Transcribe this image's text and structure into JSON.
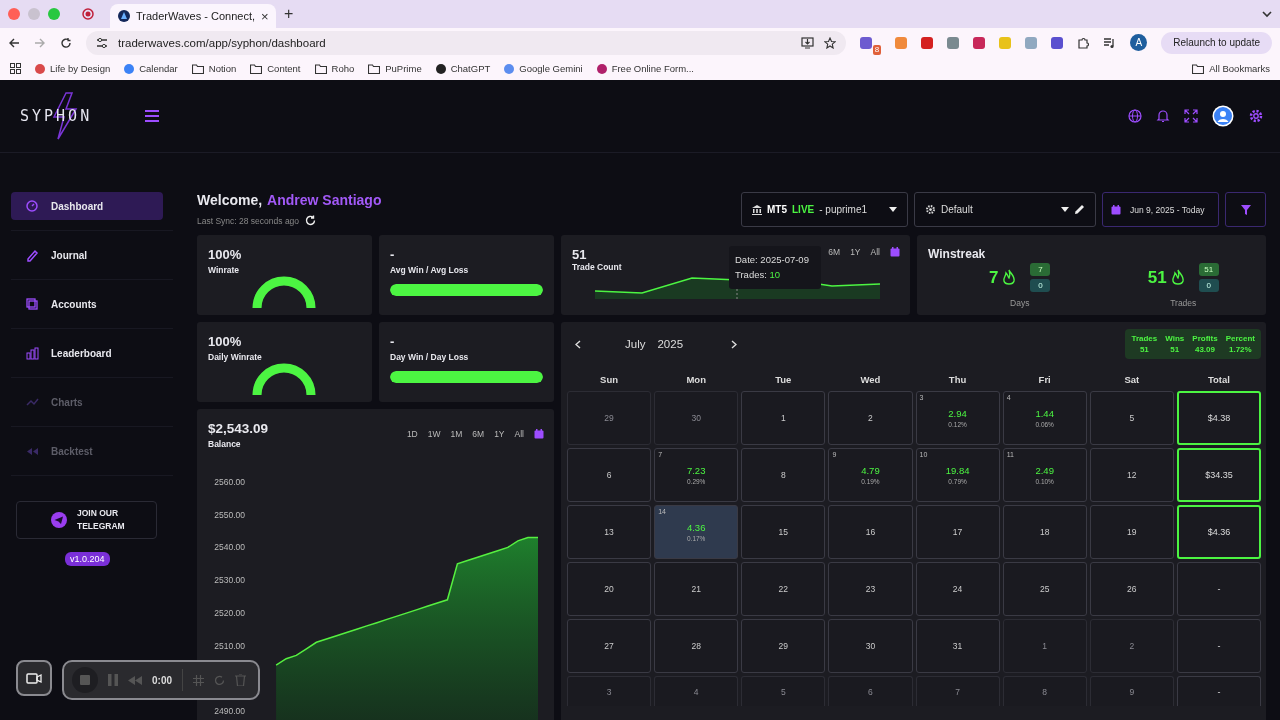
{
  "browser": {
    "tab": {
      "title": "TraderWaves - Connect,",
      "close": "×"
    },
    "new_tab": "+",
    "url": "traderwaves.com/app/syphon/dashboard",
    "extension_badge": "8",
    "profile_initial": "A",
    "relaunch": "Relaunch to update",
    "bookmarks": [
      {
        "label": "Life by Design",
        "kind": "site",
        "color": "#d94a4a"
      },
      {
        "label": "Calendar",
        "kind": "site",
        "color": "#3b82f6"
      },
      {
        "label": "Notion",
        "kind": "folder"
      },
      {
        "label": "Content",
        "kind": "folder"
      },
      {
        "label": "Roho",
        "kind": "folder"
      },
      {
        "label": "PuPrime",
        "kind": "folder"
      },
      {
        "label": "ChatGPT",
        "kind": "site",
        "color": "#222222"
      },
      {
        "label": "Google Gemini",
        "kind": "site",
        "color": "#5b8def"
      },
      {
        "label": "Free Online Form...",
        "kind": "site",
        "color": "#b0206a"
      }
    ],
    "all_bookmarks": "All Bookmarks"
  },
  "app": {
    "logo": "SYPHON",
    "sidebar": {
      "items": [
        {
          "label": "Dashboard",
          "selected": true,
          "disabled": false
        },
        {
          "label": "Journal",
          "selected": false,
          "disabled": false
        },
        {
          "label": "Accounts",
          "selected": false,
          "disabled": false
        },
        {
          "label": "Leaderboard",
          "selected": false,
          "disabled": false
        },
        {
          "label": "Charts",
          "selected": false,
          "disabled": true
        },
        {
          "label": "Backtest",
          "selected": false,
          "disabled": true
        }
      ],
      "telegram": "JOIN OUR TELEGRAM",
      "version": "v1.0.204"
    },
    "welcome": {
      "greeting": "Welcome,",
      "name": "Andrew Santiago",
      "last_sync": "Last Sync: 28 seconds ago"
    },
    "filters": {
      "account": {
        "platform": "MT5",
        "mode": "LIVE",
        "name": "- puprime1"
      },
      "layout": "Default",
      "date_range": "Jun 9, 2025 - Today"
    },
    "stats": [
      {
        "value": "100%",
        "label": "Winrate",
        "kind": "gauge",
        "level": 1
      },
      {
        "value": "-",
        "label": "Avg Win / Avg Loss",
        "kind": "bar",
        "level": 1
      },
      {
        "value": "100%",
        "label": "Daily Winrate",
        "kind": "gauge",
        "level": 1
      },
      {
        "value": "-",
        "label": "Day Win / Day Loss",
        "kind": "bar",
        "level": 1
      }
    ],
    "trade_count": {
      "value": "51",
      "label": "Trade Count",
      "ranges": [
        "6M",
        "1Y",
        "All"
      ],
      "tooltip": {
        "date": "Date: 2025-07-09",
        "label": "Trades:",
        "value": "10"
      }
    },
    "winstreak": {
      "title": "Winstreak",
      "groups": [
        {
          "value": "7",
          "wins": "7",
          "losses": "0",
          "label": "Days"
        },
        {
          "value": "51",
          "wins": "51",
          "losses": "0",
          "label": "Trades"
        }
      ]
    },
    "balance": {
      "value": "$2,543.09",
      "label": "Balance",
      "ranges": [
        "1D",
        "1W",
        "1M",
        "6M",
        "1Y",
        "All"
      ],
      "chart_data": {
        "type": "area",
        "ylim": [
          2490,
          2560
        ],
        "yticks": [
          {
            "value": 2490,
            "label": "2490.00"
          },
          {
            "value": 2510,
            "label": "2510.00"
          },
          {
            "value": 2520,
            "label": "2520.00"
          },
          {
            "value": 2530,
            "label": "2530.00"
          },
          {
            "value": 2540,
            "label": "2540.00"
          },
          {
            "value": 2550,
            "label": "2550.00"
          },
          {
            "value": 2560,
            "label": "2560.00"
          }
        ],
        "series": [
          {
            "color": "#56f040",
            "values": [
              null,
              null,
              2504,
              2506,
              2507,
              2509,
              2511,
              2512,
              2513,
              2514,
              2515,
              2516,
              2517,
              2518,
              2519,
              2520,
              2521,
              2522,
              2523,
              2524,
              2535,
              2536,
              2537,
              2538,
              2539,
              2540,
              2542,
              2543,
              2543
            ]
          }
        ]
      }
    },
    "calendar": {
      "month": "July",
      "year": "2025",
      "summary": [
        {
          "label": "Trades",
          "value": "51"
        },
        {
          "label": "Wins",
          "value": "51"
        },
        {
          "label": "Profits",
          "value": "43.09"
        },
        {
          "label": "Percent",
          "value": "1.72%"
        }
      ],
      "weekdays": [
        "Sun",
        "Mon",
        "Tue",
        "Wed",
        "Thu",
        "Fri",
        "Sat",
        "Total"
      ],
      "weeks": [
        {
          "days": [
            {
              "day": "29",
              "kind": "outside",
              "selected": false
            },
            {
              "day": "30",
              "kind": "outside",
              "selected": false
            },
            {
              "day": "1",
              "kind": "plain",
              "selected": false
            },
            {
              "day": "2",
              "kind": "plain",
              "selected": false
            },
            {
              "day": "3",
              "kind": "trade",
              "profit": "2.94",
              "percent": "0.12%",
              "selected": false
            },
            {
              "day": "4",
              "kind": "trade",
              "profit": "1.44",
              "percent": "0.06%",
              "selected": false
            },
            {
              "day": "5",
              "kind": "plain",
              "selected": false
            }
          ],
          "total": {
            "value": "$4.38",
            "highlighted": true
          }
        },
        {
          "days": [
            {
              "day": "6",
              "kind": "plain",
              "selected": false
            },
            {
              "day": "7",
              "kind": "trade",
              "profit": "7.23",
              "percent": "0.29%",
              "selected": false
            },
            {
              "day": "8",
              "kind": "plain",
              "selected": false
            },
            {
              "day": "9",
              "kind": "trade",
              "profit": "4.79",
              "percent": "0.19%",
              "selected": false
            },
            {
              "day": "10",
              "kind": "trade",
              "profit": "19.84",
              "percent": "0.79%",
              "selected": false
            },
            {
              "day": "11",
              "kind": "trade",
              "profit": "2.49",
              "percent": "0.10%",
              "selected": false
            },
            {
              "day": "12",
              "kind": "plain",
              "selected": false
            }
          ],
          "total": {
            "value": "$34.35",
            "highlighted": true
          }
        },
        {
          "days": [
            {
              "day": "13",
              "kind": "plain",
              "selected": false
            },
            {
              "day": "14",
              "kind": "trade",
              "profit": "4.36",
              "percent": "0.17%",
              "selected": true
            },
            {
              "day": "15",
              "kind": "plain",
              "selected": false
            },
            {
              "day": "16",
              "kind": "plain",
              "selected": false
            },
            {
              "day": "17",
              "kind": "plain",
              "selected": false
            },
            {
              "day": "18",
              "kind": "plain",
              "selected": false
            },
            {
              "day": "19",
              "kind": "plain",
              "selected": false
            }
          ],
          "total": {
            "value": "$4.36",
            "highlighted": true
          }
        },
        {
          "days": [
            {
              "day": "20",
              "kind": "plain",
              "selected": false
            },
            {
              "day": "21",
              "kind": "plain",
              "selected": false
            },
            {
              "day": "22",
              "kind": "plain",
              "selected": false
            },
            {
              "day": "23",
              "kind": "plain",
              "selected": false
            },
            {
              "day": "24",
              "kind": "plain",
              "selected": false
            },
            {
              "day": "25",
              "kind": "plain",
              "selected": false
            },
            {
              "day": "26",
              "kind": "plain",
              "selected": false
            }
          ],
          "total": {
            "value": "-",
            "highlighted": false
          }
        },
        {
          "days": [
            {
              "day": "27",
              "kind": "plain",
              "selected": false
            },
            {
              "day": "28",
              "kind": "plain",
              "selected": false
            },
            {
              "day": "29",
              "kind": "plain",
              "selected": false
            },
            {
              "day": "30",
              "kind": "plain",
              "selected": false
            },
            {
              "day": "31",
              "kind": "plain",
              "selected": false
            },
            {
              "day": "1",
              "kind": "outside",
              "selected": false
            },
            {
              "day": "2",
              "kind": "outside",
              "selected": false
            }
          ],
          "total": {
            "value": "-",
            "highlighted": false
          }
        },
        {
          "days": [
            {
              "day": "3",
              "kind": "outside",
              "selected": false
            },
            {
              "day": "4",
              "kind": "outside",
              "selected": false
            },
            {
              "day": "5",
              "kind": "outside",
              "selected": false
            },
            {
              "day": "6",
              "kind": "outside",
              "selected": false
            },
            {
              "day": "7",
              "kind": "outside",
              "selected": false
            },
            {
              "day": "8",
              "kind": "outside",
              "selected": false
            },
            {
              "day": "9",
              "kind": "outside",
              "selected": false
            }
          ],
          "total": {
            "value": "-",
            "highlighted": false
          }
        }
      ]
    },
    "recorder": {
      "time": "0:00"
    }
  }
}
